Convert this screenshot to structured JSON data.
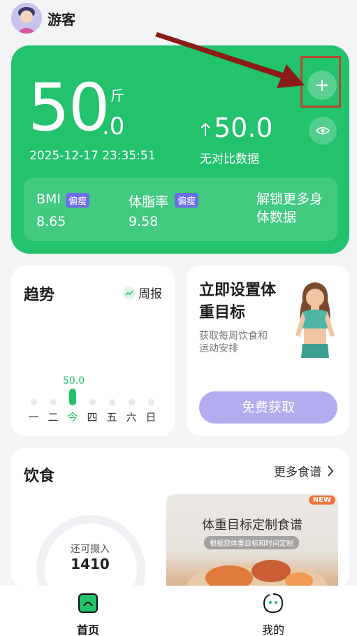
{
  "header": {
    "username": "游客"
  },
  "weight": {
    "integer": "50",
    "decimal": ".0",
    "unit": "斤",
    "timestamp": "2025-12-17 23:35:51",
    "compare_value": "50.0",
    "compare_label": "无对比数据"
  },
  "metrics": {
    "bmi_label": "BMI",
    "bmi_badge": "偏瘦",
    "bmi_value": "8.65",
    "fat_label": "体脂率",
    "fat_badge": "偏瘦",
    "fat_value": "9.58",
    "unlock_text": "解锁更多身体数据"
  },
  "trend": {
    "title": "趋势",
    "weekly_report": "周报",
    "bar_value": "50.0",
    "days": [
      "一",
      "二",
      "今",
      "四",
      "五",
      "六",
      "日"
    ],
    "active_day_index": 2
  },
  "goal": {
    "title": "立即设置体重目标",
    "description": "获取每周饮食和运动安排",
    "button_label": "免费获取"
  },
  "diet": {
    "title": "饮食",
    "more_recipes": "更多食谱",
    "gauge_label": "还可摄入",
    "gauge_value": "1410",
    "recipe_title": "体重目标定制食谱",
    "recipe_subtitle": "根据您体重目标和时间定制",
    "new_tag": "NEW"
  },
  "nav": {
    "home": "首页",
    "me": "我的"
  },
  "colors": {
    "accent": "#23c26d",
    "button_purple": "#b3acef",
    "highlight": "#b5482f"
  }
}
